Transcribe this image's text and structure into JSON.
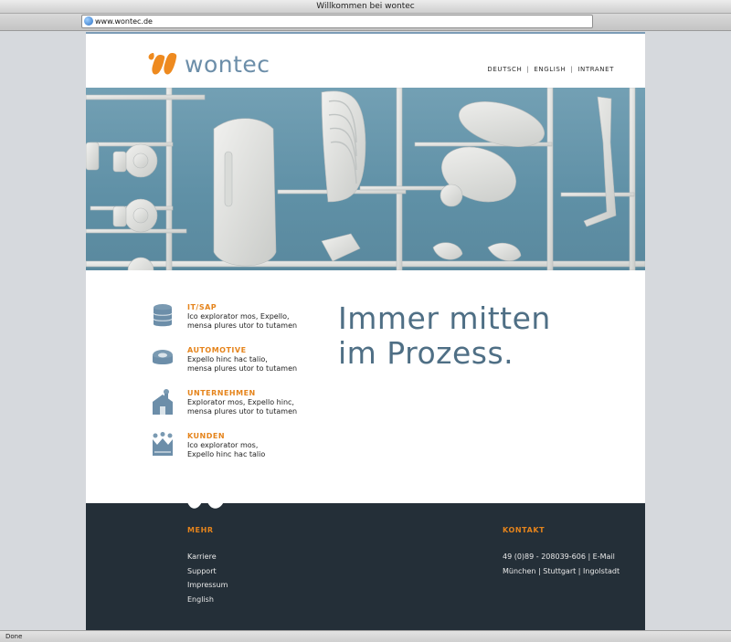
{
  "window": {
    "title": "Willkommen bei wontec"
  },
  "browser": {
    "url": "www.wontec.de",
    "status": "Done"
  },
  "header": {
    "logo_text": "wontec",
    "lang_nav": [
      "DEUTSCH",
      "ENGLISH",
      "INTRANET"
    ]
  },
  "features": [
    {
      "icon": "database-icon",
      "title": "IT/SAP",
      "line1": "Ico explorator mos, Expello,",
      "line2": "mensa plures utor to tutamen"
    },
    {
      "icon": "wheel-icon",
      "title": "AUTOMOTIVE",
      "line1": "Expello hinc hac talio,",
      "line2": "mensa plures utor to tutamen"
    },
    {
      "icon": "factory-icon",
      "title": "UNTERNEHMEN",
      "line1": "Explorator mos, Expello hinc,",
      "line2": "mensa plures utor to tutamen"
    },
    {
      "icon": "crown-icon",
      "title": "KUNDEN",
      "line1": "Ico explorator mos,",
      "line2": "Expello hinc hac talio"
    }
  ],
  "headline": {
    "line1": "Immer mitten",
    "line2": "im Prozess."
  },
  "footer": {
    "mehr": {
      "title": "MEHR",
      "links": [
        "Karriere",
        "Support",
        "Impressum",
        "English"
      ]
    },
    "kontakt": {
      "title": "KONTAKT",
      "phone": "49 (0)89 - 208039-606 | E-Mail",
      "cities": "München | Stuttgart | Ingolstadt"
    }
  },
  "colors": {
    "accent": "#e5841c",
    "brand_blue": "#6c8ea9",
    "footer_bg": "#242f38",
    "hero_bg": "#6a98ad"
  }
}
